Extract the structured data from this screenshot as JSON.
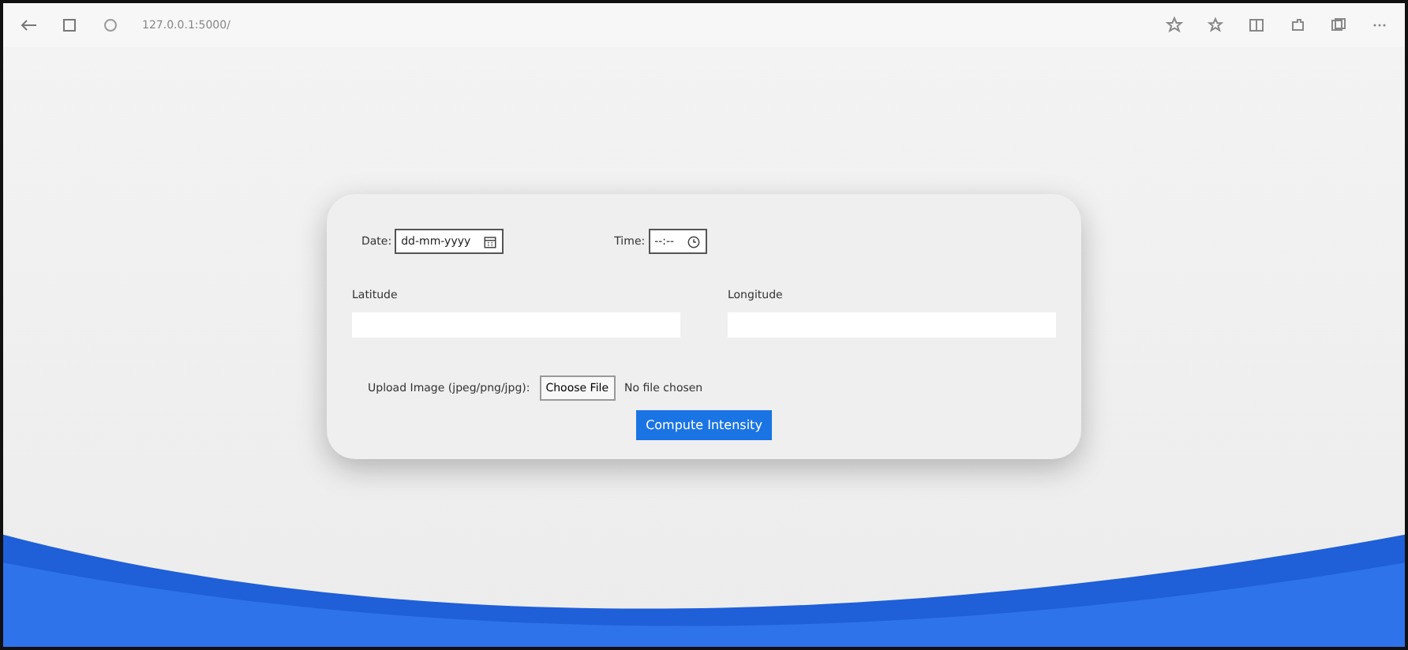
{
  "browser": {
    "url": "127.0.0.1:5000/"
  },
  "form": {
    "date": {
      "label": "Date:",
      "placeholder": "dd-mm-yyyy"
    },
    "time": {
      "label": "Time:",
      "placeholder": "--:--"
    },
    "latitude": {
      "label": "Latitude"
    },
    "longitude": {
      "label": "Longitude"
    },
    "upload": {
      "label": "Upload Image (jpeg/png/jpg):",
      "button": "Choose File",
      "status": "No file chosen"
    },
    "submit": "Compute Intensity"
  }
}
